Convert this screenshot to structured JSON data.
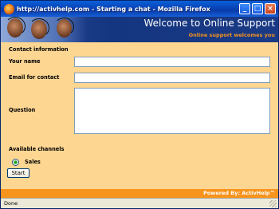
{
  "window": {
    "title": "http://activhelp.com - Starting a chat - Mozilla Firefox",
    "controls": {
      "minimize": "_",
      "maximize": "□",
      "close": "×"
    }
  },
  "banner": {
    "heading": "Welcome to Online Support",
    "subheading": "Online support welcomes you"
  },
  "form": {
    "section_title": "Contact information",
    "name_label": "Your name",
    "name_value": "",
    "email_label": "Email for contact",
    "email_value": "",
    "question_label": "Question",
    "question_value": "",
    "channels_title": "Available channels",
    "channels": [
      {
        "label": "Sales",
        "selected": true
      }
    ],
    "start_label": "Start"
  },
  "footer": {
    "powered_by": "Powered By: ActivHelp™"
  },
  "status": {
    "text": "Done"
  },
  "colors": {
    "accent_orange": "#f7941d",
    "form_background": "#fdd692",
    "banner_blue": "#1a3a86"
  }
}
